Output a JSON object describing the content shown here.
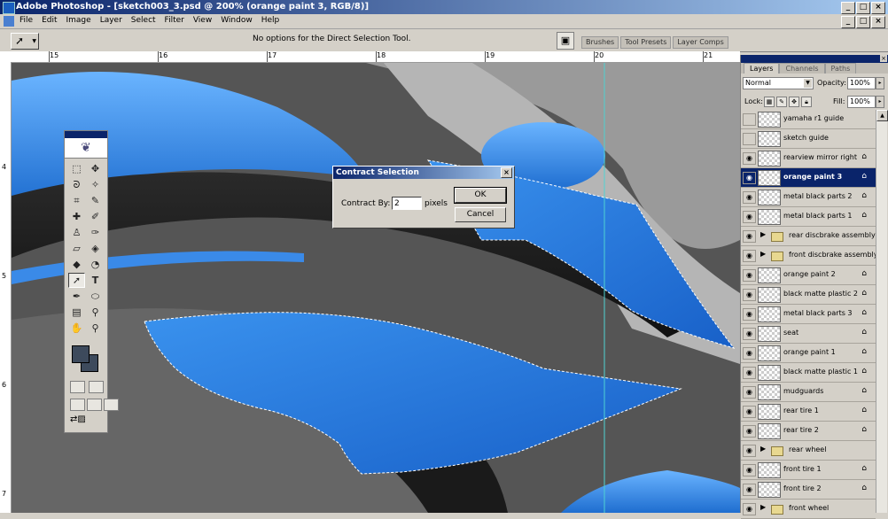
{
  "window": {
    "title": "Adobe Photoshop - [sketch003_3.psd @ 200% (orange paint 3, RGB/8)]",
    "minimize": "_",
    "maximize": "□",
    "close": "×"
  },
  "menu": [
    "File",
    "Edit",
    "Image",
    "Layer",
    "Select",
    "Filter",
    "View",
    "Window",
    "Help"
  ],
  "options_bar": {
    "message": "No options for the Direct Selection Tool.",
    "palette_well": [
      "Brushes",
      "Tool Presets",
      "Layer Comps"
    ]
  },
  "rulers": {
    "top": [
      "15",
      "16",
      "17",
      "18",
      "19",
      "20",
      "21"
    ],
    "left": [
      "4",
      "5",
      "6",
      "7"
    ]
  },
  "dialog": {
    "title": "Contract Selection",
    "label": "Contract By:",
    "value": "2",
    "unit": "pixels",
    "ok": "OK",
    "cancel": "Cancel"
  },
  "layers_panel": {
    "tabs": [
      "Layers",
      "Channels",
      "Paths"
    ],
    "blend_mode": "Normal",
    "opacity_label": "Opacity:",
    "opacity": "100%",
    "lock_label": "Lock:",
    "fill_label": "Fill:",
    "fill": "100%",
    "layers": [
      {
        "name": "yamaha r1 guide",
        "visible": false,
        "group": false,
        "locked": false,
        "selected": false
      },
      {
        "name": "sketch guide",
        "visible": false,
        "group": false,
        "locked": false,
        "selected": false
      },
      {
        "name": "rearview mirror right",
        "visible": true,
        "group": false,
        "locked": true,
        "selected": false
      },
      {
        "name": "orange paint 3",
        "visible": true,
        "group": false,
        "locked": true,
        "selected": true
      },
      {
        "name": "metal black parts 2",
        "visible": true,
        "group": false,
        "locked": true,
        "selected": false
      },
      {
        "name": "metal black parts 1",
        "visible": true,
        "group": false,
        "locked": true,
        "selected": false
      },
      {
        "name": "rear discbrake assembly",
        "visible": true,
        "group": true,
        "locked": false,
        "selected": false
      },
      {
        "name": "front discbrake assembly",
        "visible": true,
        "group": true,
        "locked": false,
        "selected": false
      },
      {
        "name": "orange paint 2",
        "visible": true,
        "group": false,
        "locked": true,
        "selected": false
      },
      {
        "name": "black matte plastic 2",
        "visible": true,
        "group": false,
        "locked": true,
        "selected": false
      },
      {
        "name": "metal black parts 3",
        "visible": true,
        "group": false,
        "locked": true,
        "selected": false
      },
      {
        "name": "seat",
        "visible": true,
        "group": false,
        "locked": true,
        "selected": false
      },
      {
        "name": "orange paint 1",
        "visible": true,
        "group": false,
        "locked": true,
        "selected": false
      },
      {
        "name": "black matte plastic 1",
        "visible": true,
        "group": false,
        "locked": true,
        "selected": false
      },
      {
        "name": "mudguards",
        "visible": true,
        "group": false,
        "locked": true,
        "selected": false
      },
      {
        "name": "rear tire 1",
        "visible": true,
        "group": false,
        "locked": true,
        "selected": false
      },
      {
        "name": "rear tire 2",
        "visible": true,
        "group": false,
        "locked": true,
        "selected": false
      },
      {
        "name": "rear wheel",
        "visible": true,
        "group": true,
        "locked": false,
        "selected": false
      },
      {
        "name": "front tire 1",
        "visible": true,
        "group": false,
        "locked": true,
        "selected": false
      },
      {
        "name": "front tire 2",
        "visible": true,
        "group": false,
        "locked": true,
        "selected": false
      },
      {
        "name": "front wheel",
        "visible": true,
        "group": true,
        "locked": false,
        "selected": false
      }
    ]
  },
  "colors": {
    "foreground": "#3d4a5c",
    "background": "#3d4a5c",
    "paint_blue": "#2d82e0",
    "title_bar": "#0a246a"
  }
}
